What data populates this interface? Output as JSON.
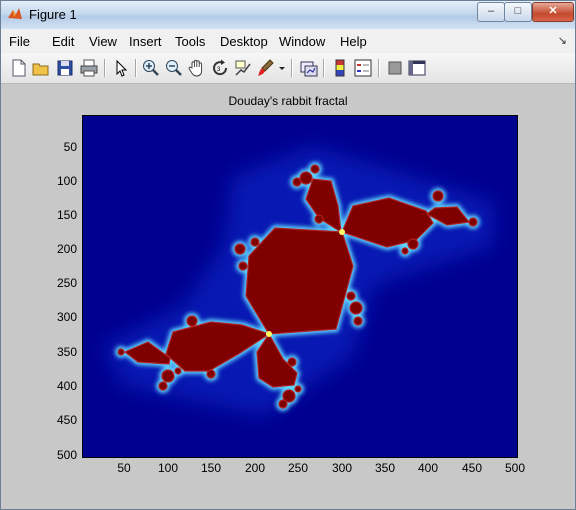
{
  "window": {
    "title": "Figure 1",
    "minimize_label": "–",
    "maximize_label": "□",
    "close_label": "✕"
  },
  "menu": {
    "items": [
      "File",
      "Edit",
      "View",
      "Insert",
      "Tools",
      "Desktop",
      "Window",
      "Help"
    ],
    "overflow_icon": "dock-arrow-icon"
  },
  "toolbar": {
    "icons": [
      "new-figure-icon",
      "open-file-icon",
      "save-icon",
      "print-icon",
      "pointer-icon",
      "zoom-in-icon",
      "zoom-out-icon",
      "pan-hand-icon",
      "rotate-3d-icon",
      "data-cursor-icon",
      "brush-icon",
      "brush-dropdown-icon",
      "link-plot-icon",
      "colorbar-icon",
      "legend-icon",
      "hide-plot-tools-icon",
      "show-plot-tools-icon"
    ]
  },
  "plot": {
    "title": "Douday's rabbit fractal",
    "colors": {
      "background": "#00008f",
      "inner": "#800000",
      "halo": "#0a3cd8",
      "edge": "#7fffff"
    }
  },
  "chart_data": {
    "type": "heatmap",
    "title": "Douday's rabbit fractal",
    "xlabel": "",
    "ylabel": "",
    "xlim": [
      0,
      500
    ],
    "ylim": [
      500,
      0
    ],
    "x_ticks": [
      "50",
      "100",
      "150",
      "200",
      "250",
      "300",
      "350",
      "400",
      "450",
      "500"
    ],
    "y_ticks": [
      "50",
      "100",
      "150",
      "200",
      "250",
      "300",
      "350",
      "400",
      "450",
      "500"
    ],
    "colormap": "jet",
    "grid": false
  }
}
